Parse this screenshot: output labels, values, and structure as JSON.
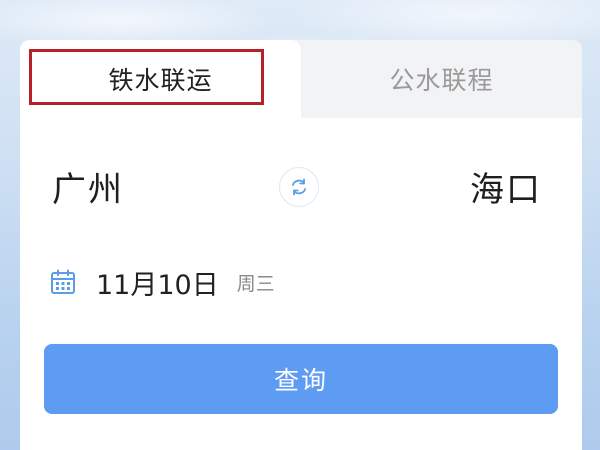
{
  "tabs": [
    {
      "label": "铁水联运",
      "active": true
    },
    {
      "label": "公水联程",
      "active": false
    }
  ],
  "route": {
    "from": "广州",
    "to": "海口",
    "swap_icon": "swap-arrows-icon"
  },
  "date": {
    "icon": "calendar-icon",
    "value": "11月10日",
    "weekday": "周三"
  },
  "search": {
    "label": "查询"
  },
  "colors": {
    "primary_button": "#5d9cf2",
    "highlight_border": "#b5222a",
    "icon_blue": "#5a9de6"
  }
}
